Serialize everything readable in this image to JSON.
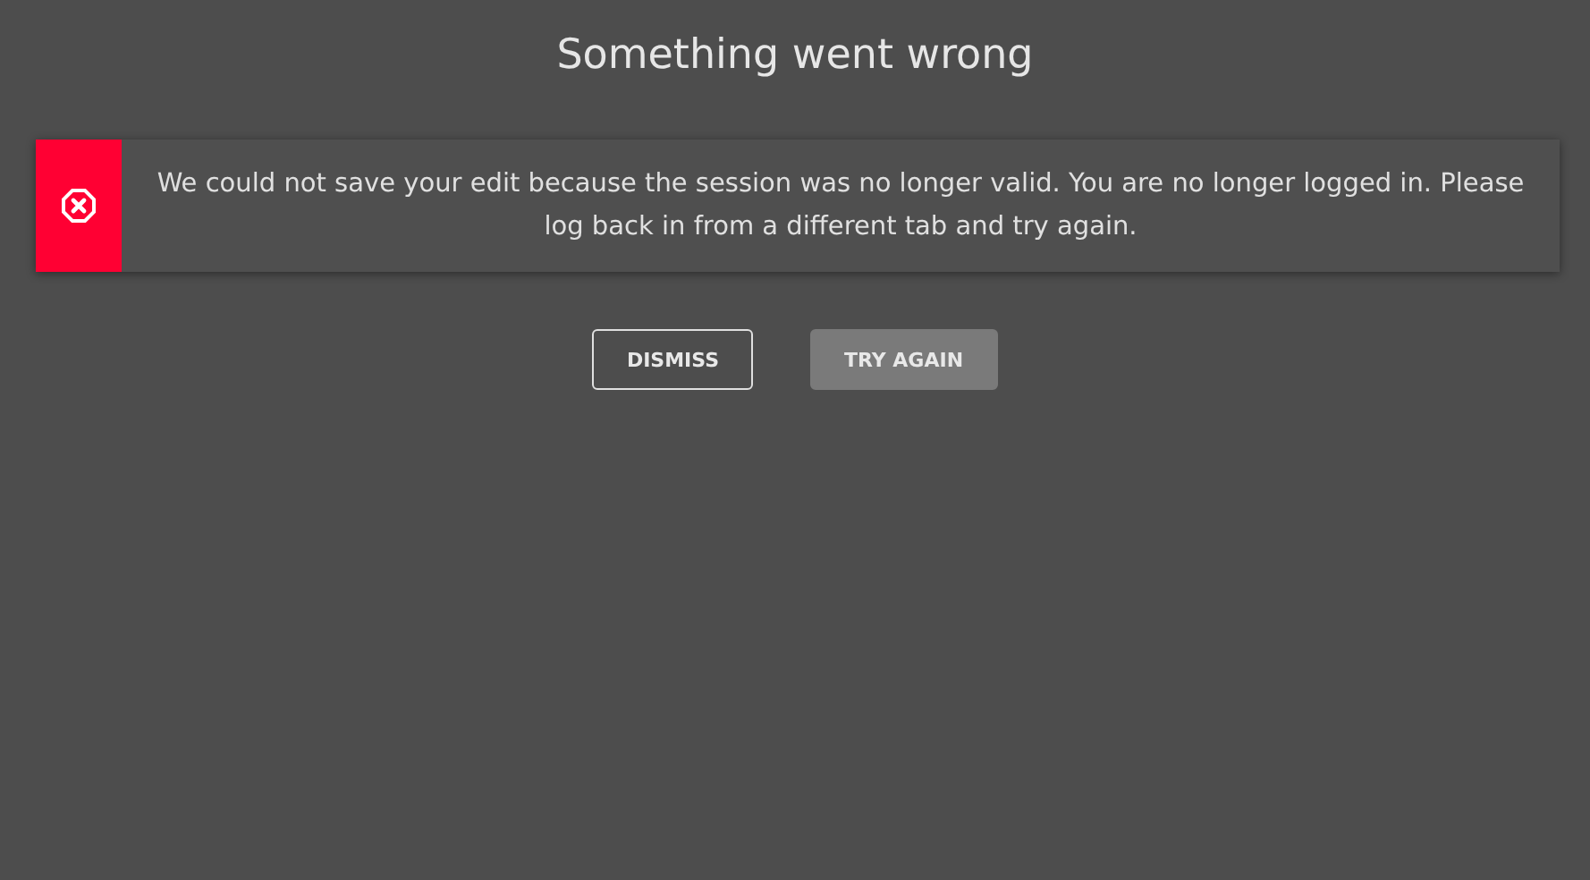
{
  "dialog": {
    "title": "Something went wrong",
    "alert": {
      "kind": "error",
      "message": "We could not save your edit because the session was no longer valid. You are no longer logged in. Please log back in from a different tab and try again."
    },
    "buttons": [
      {
        "label": "DISMISS",
        "kind": "outline"
      },
      {
        "label": "TRY AGAIN",
        "kind": "filled"
      }
    ]
  }
}
